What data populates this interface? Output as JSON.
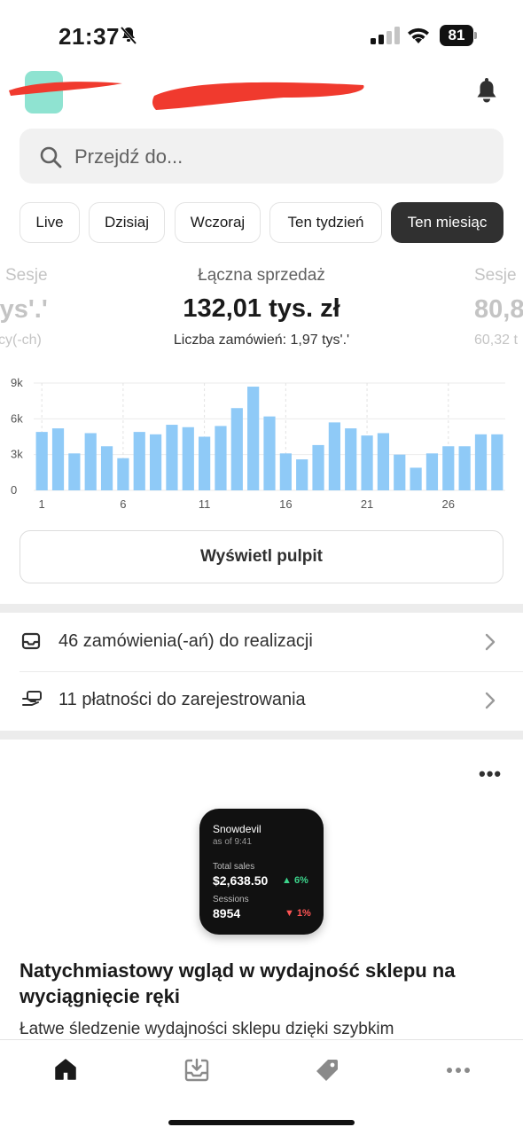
{
  "status_bar": {
    "time": "21:37",
    "battery": "81"
  },
  "search": {
    "placeholder": "Przejdź do..."
  },
  "chips": [
    {
      "label": "Live"
    },
    {
      "label": "Dzisiaj"
    },
    {
      "label": "Wczoraj"
    },
    {
      "label": "Ten tydzień"
    },
    {
      "label": "Ten miesiąc",
      "active": true
    }
  ],
  "metrics": {
    "left": {
      "label": "Sesje",
      "value": "tys'.'",
      "sub": "cy(-ch)"
    },
    "center": {
      "label": "Łączna sprzedaż",
      "value": "132,01 tys. zł",
      "sub": "Liczba zamówień: 1,97 tys'.'"
    },
    "right": {
      "label": "Sesje",
      "value": "80,8",
      "sub": "60,32 t"
    }
  },
  "chart_data": {
    "type": "bar",
    "x": [
      1,
      2,
      3,
      4,
      5,
      6,
      7,
      8,
      9,
      10,
      11,
      12,
      13,
      14,
      15,
      16,
      17,
      18,
      19,
      20,
      21,
      22,
      23,
      24,
      25,
      26,
      27,
      28,
      29
    ],
    "values": [
      4900,
      5200,
      3100,
      4800,
      3700,
      2700,
      4900,
      4700,
      5500,
      5300,
      4500,
      5400,
      6900,
      8700,
      6200,
      3100,
      2600,
      3800,
      5700,
      5200,
      4600,
      4800,
      3000,
      1900,
      3100,
      3700,
      3700,
      4700,
      4700
    ],
    "x_ticks": [
      "1",
      "6",
      "11",
      "16",
      "21",
      "26"
    ],
    "y_ticks": [
      "0",
      "3k",
      "6k",
      "9k"
    ],
    "ylim": [
      0,
      9000
    ],
    "color": "#8fcaf7",
    "grid": true
  },
  "dashboard_button": {
    "label": "Wyświetl pulpit"
  },
  "tasks": [
    {
      "text": "46 zamówienia(-ań) do realizacji",
      "icon": "inbox-icon"
    },
    {
      "text": "11 płatności do zarejestrowania",
      "icon": "hand-payment-icon"
    }
  ],
  "promo": {
    "watch": {
      "store": "Snowdevil",
      "as_of": "as of 9:41",
      "sales_label": "Total sales",
      "sales_value": "$2,638.50",
      "sales_change": "▲ 6%",
      "sessions_label": "Sessions",
      "sessions_value": "8954",
      "sessions_change": "▼ 1%"
    },
    "title": "Natychmiastowy wgląd w wydajność sklepu na wyciągnięcie ręki",
    "body": "Łatwe śledzenie wydajności sklepu dzięki szybkim"
  },
  "more_menu": "•••",
  "tabbar": [
    {
      "name": "home",
      "icon": "home-icon",
      "active": true
    },
    {
      "name": "orders",
      "icon": "inbox-download-icon"
    },
    {
      "name": "products",
      "icon": "tag-icon"
    },
    {
      "name": "more",
      "icon": "more-icon"
    }
  ]
}
